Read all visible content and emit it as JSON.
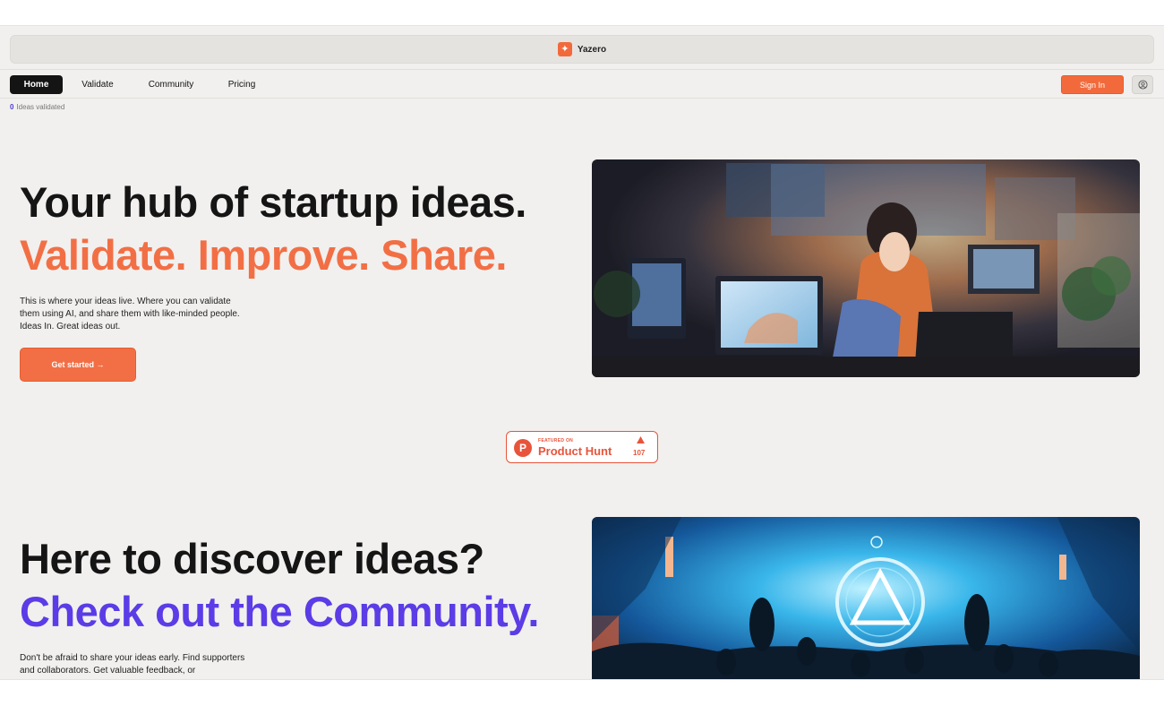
{
  "brand": {
    "name": "Yazero",
    "logo_icon": "sparkle-icon",
    "accent": "#f26a3c"
  },
  "nav": {
    "items": [
      {
        "label": "Home",
        "active": true
      },
      {
        "label": "Validate",
        "active": false
      },
      {
        "label": "Community",
        "active": false
      },
      {
        "label": "Pricing",
        "active": false
      }
    ],
    "signin_label": "Sign In",
    "user_icon": "user-circle-icon"
  },
  "stats": {
    "count": "0",
    "label": "Ideas validated"
  },
  "hero": {
    "title": "Your hub of startup ideas.",
    "subtitle": "Validate. Improve. Share.",
    "description": "This is where your ideas live. Where you can validate them using AI, and share them with like-minded people. Ideas In. Great ideas out.",
    "cta_label": "Get started →",
    "image_desc": "anime-girl-at-computer-illustration"
  },
  "product_hunt": {
    "featured_label": "FEATURED ON",
    "name": "Product Hunt",
    "upvotes": "107",
    "color": "#e8543b"
  },
  "community": {
    "title": "Here to discover ideas?",
    "subtitle": "Check out the Community.",
    "description": "Don't be afraid to share your ideas early. Find supporters and collaborators. Get valuable feedback, or",
    "image_desc": "community-gathering-illustration"
  },
  "colors": {
    "orange": "#f26f45",
    "purple": "#5b3ce6",
    "background": "#f1f0ee"
  }
}
